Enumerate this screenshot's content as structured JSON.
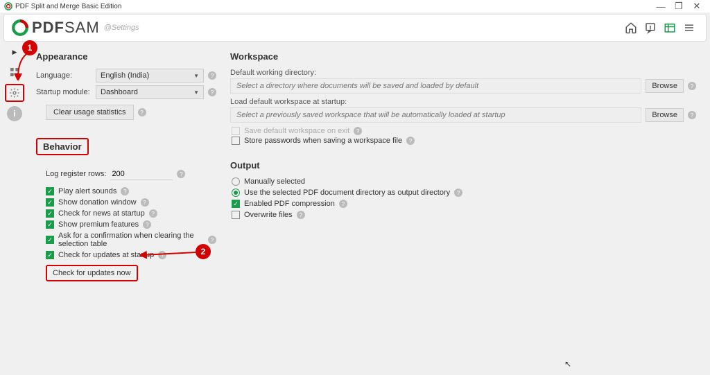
{
  "window": {
    "title": "PDF Split and Merge Basic Edition"
  },
  "header": {
    "logo_main": "PDF",
    "logo_sub": "SAM",
    "breadcrumb": "@Settings"
  },
  "appearance": {
    "title": "Appearance",
    "language_label": "Language:",
    "language_value": "English (India)",
    "startup_label": "Startup module:",
    "startup_value": "Dashboard",
    "clear_stats": "Clear usage statistics"
  },
  "behavior": {
    "title": "Behavior",
    "log_label": "Log register rows:",
    "log_value": "200",
    "play_sounds": "Play alert sounds",
    "donation": "Show donation window",
    "news": "Check for news at startup",
    "premium": "Show premium features",
    "confirm_clear": "Ask for a confirmation when clearing the selection table",
    "updates_startup": "Check for updates at startup",
    "check_now": "Check for updates now"
  },
  "workspace": {
    "title": "Workspace",
    "dir_label": "Default working directory:",
    "dir_placeholder": "Select a directory where documents will be saved and loaded by default",
    "load_label": "Load default workspace at startup:",
    "load_placeholder": "Select a previously saved workspace that will be automatically loaded at startup",
    "browse": "Browse",
    "save_on_exit": "Save default workspace on exit",
    "store_passwords": "Store passwords when saving a workspace file"
  },
  "output": {
    "title": "Output",
    "manual": "Manually selected",
    "use_selected": "Use the selected PDF document directory as output directory",
    "compression": "Enabled PDF compression",
    "overwrite": "Overwrite files"
  },
  "annotations": {
    "one": "1",
    "two": "2"
  }
}
